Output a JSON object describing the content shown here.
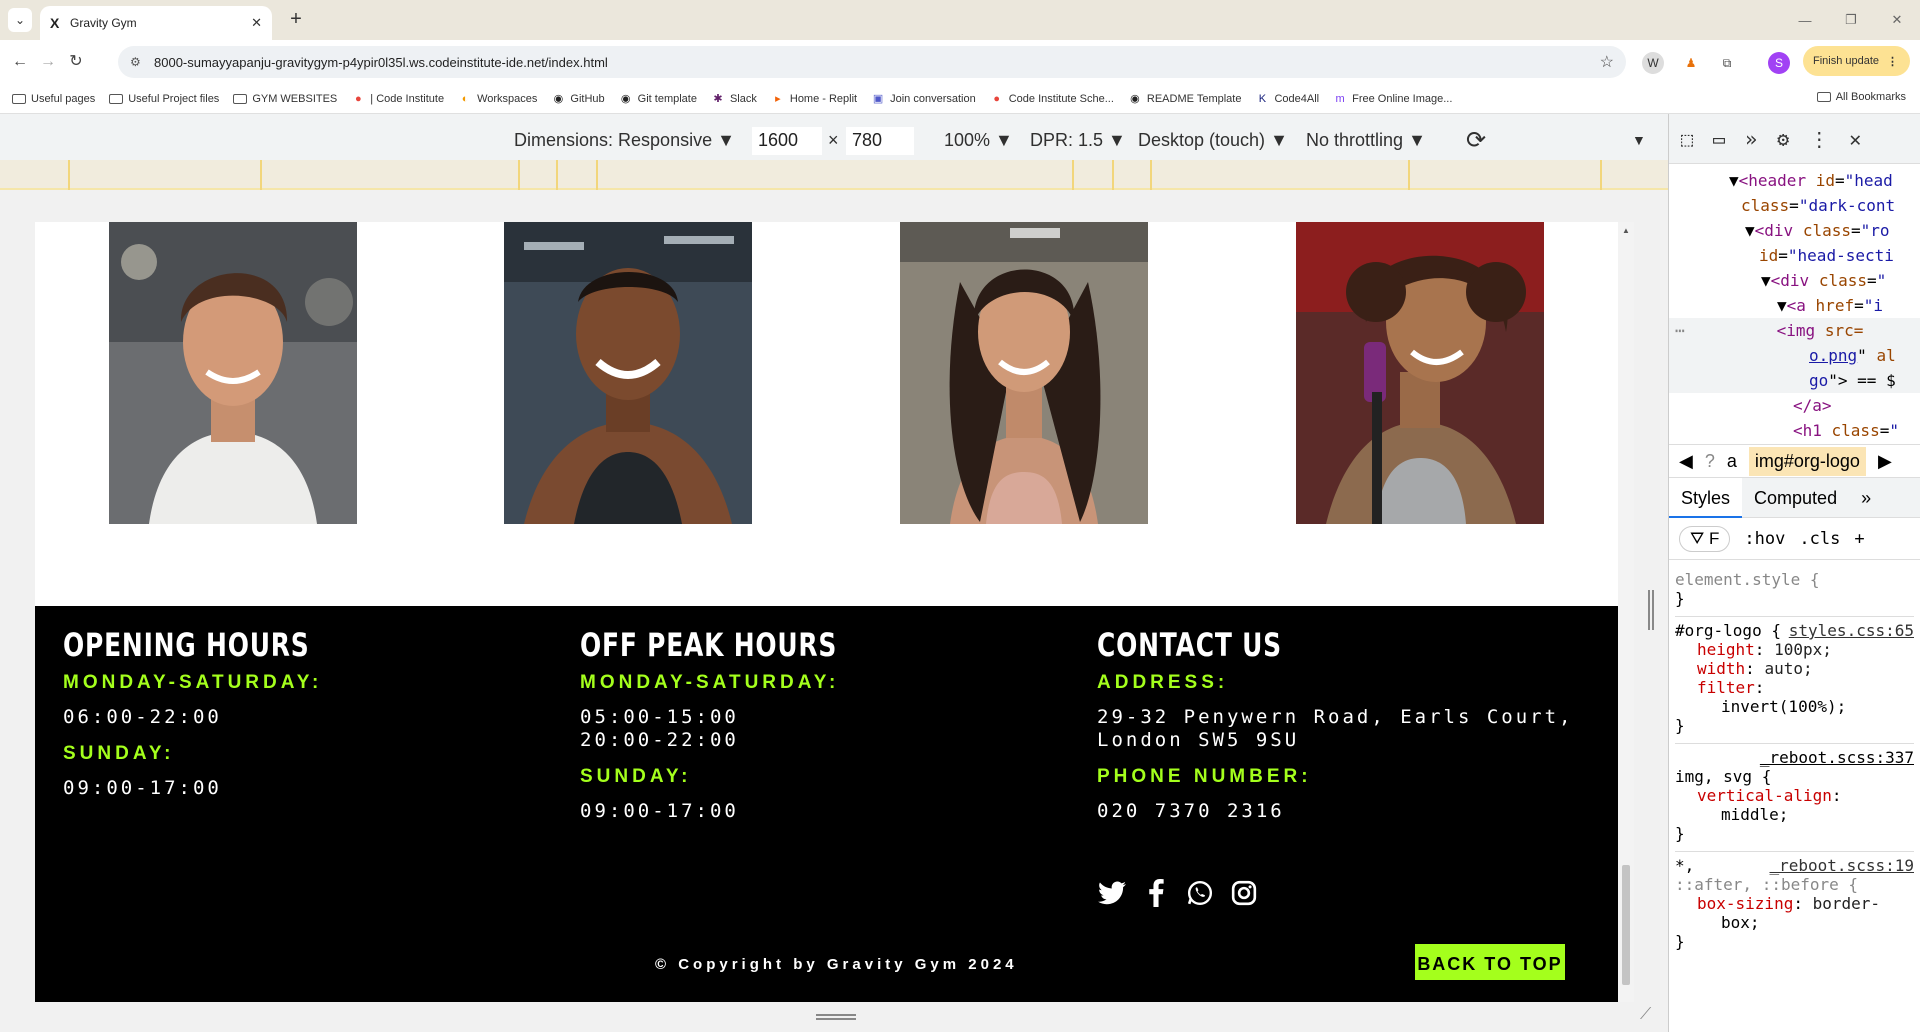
{
  "browser": {
    "tab_title": "Gravity Gym",
    "tab_favicon": "X",
    "url": "8000-sumayyapanju-gravitygym-p4ypir0l35l.ws.codeinstitute-ide.net/index.html",
    "finish_update_label": "Finish update",
    "profile_initial": "S"
  },
  "bookmarks": [
    {
      "label": "Useful pages",
      "icon": "folder-icon"
    },
    {
      "label": "Useful Project files",
      "icon": "folder-icon"
    },
    {
      "label": "GYM WEBSITES",
      "icon": "folder-icon"
    },
    {
      "label": "| Code Institute",
      "icon": "ci-icon"
    },
    {
      "label": "Workspaces",
      "icon": "workspaces-icon"
    },
    {
      "label": "GitHub",
      "icon": "github-icon"
    },
    {
      "label": "Git template",
      "icon": "github-icon"
    },
    {
      "label": "Slack",
      "icon": "slack-icon"
    },
    {
      "label": "Home - Replit",
      "icon": "replit-icon"
    },
    {
      "label": "Join conversation",
      "icon": "teams-icon"
    },
    {
      "label": "Code Institute Sche...",
      "icon": "ci-icon"
    },
    {
      "label": "README Template",
      "icon": "github-icon"
    },
    {
      "label": "Code4All",
      "icon": "k-icon"
    },
    {
      "label": "Free Online Image...",
      "icon": "m-icon"
    }
  ],
  "all_bookmarks_label": "All Bookmarks",
  "device_toolbar": {
    "dimensions": "Dimensions: Responsive",
    "width": "1600",
    "times": "×",
    "height": "780",
    "zoom": "100%",
    "dpr": "DPR: 1.5",
    "device_type": "Desktop (touch)",
    "throttling": "No throttling"
  },
  "footer": {
    "opening": {
      "title": "OPENING HOURS",
      "weekday_label": "MONDAY-SATURDAY:",
      "weekday_value": "06:00-22:00",
      "sunday_label": "SUNDAY:",
      "sunday_value": "09:00-17:00"
    },
    "offpeak": {
      "title": "OFF PEAK HOURS",
      "weekday_label": "MONDAY-SATURDAY:",
      "weekday_value_1": "05:00-15:00",
      "weekday_value_2": "20:00-22:00",
      "sunday_label": "SUNDAY:",
      "sunday_value": "09:00-17:00"
    },
    "contact": {
      "title": "CONTACT US",
      "address_label": "ADDRESS:",
      "address_line_1": "29-32 Penywern Road, Earls Court,",
      "address_line_2": "London SW5 9SU",
      "phone_label": "PHONE NUMBER:",
      "phone_value": "020 7370 2316"
    },
    "copyright": "© Copyright by Gravity Gym 2024",
    "back_to_top": "BACK TO TOP",
    "accent_color": "#a4ff1c"
  },
  "devtools": {
    "dom": [
      {
        "tag": "header",
        "attr": "id",
        "val": "head"
      },
      {
        "text": "class=\"dark-cont"
      },
      {
        "tag": "div",
        "attr": "class",
        "val": "ro"
      },
      {
        "text": "id=\"head-secti"
      },
      {
        "tag": "div",
        "attr": "class",
        "val": ""
      },
      {
        "tag": "a",
        "attr": "href",
        "val": "i"
      },
      {
        "tag": "img",
        "attr": "src",
        "val": ""
      },
      {
        "text": "o.png\" al"
      },
      {
        "text": "go\">"
      },
      {
        "text": "</a>"
      },
      {
        "tag": "h1",
        "attr": "class",
        "val": ""
      }
    ],
    "breadcrumb_a": "a",
    "breadcrumb_current": "img#org-logo",
    "tabs": [
      "Styles",
      "Computed"
    ],
    "filter_placeholder": "F",
    "hov": ":hov",
    "cls": ".cls",
    "element_style": "element.style {",
    "rule1": {
      "selector": "#org-logo {",
      "source": "styles.css:65",
      "props": [
        {
          "name": "height",
          "value": "100px;"
        },
        {
          "name": "width",
          "value": "auto;"
        },
        {
          "name": "filter",
          "value": ""
        }
      ],
      "filter_value": "invert(100%);"
    },
    "rule2": {
      "source": "_reboot.scss:337",
      "selector": "img, svg {",
      "prop": "vertical-align",
      "value": "middle;"
    },
    "rule3": {
      "source": "_reboot.scss:19",
      "selector": "*,",
      "selector2": "::after, ::before {",
      "prop": "box-sizing",
      "value": "border-",
      "value2": "box;"
    },
    "close_brace": "}"
  }
}
